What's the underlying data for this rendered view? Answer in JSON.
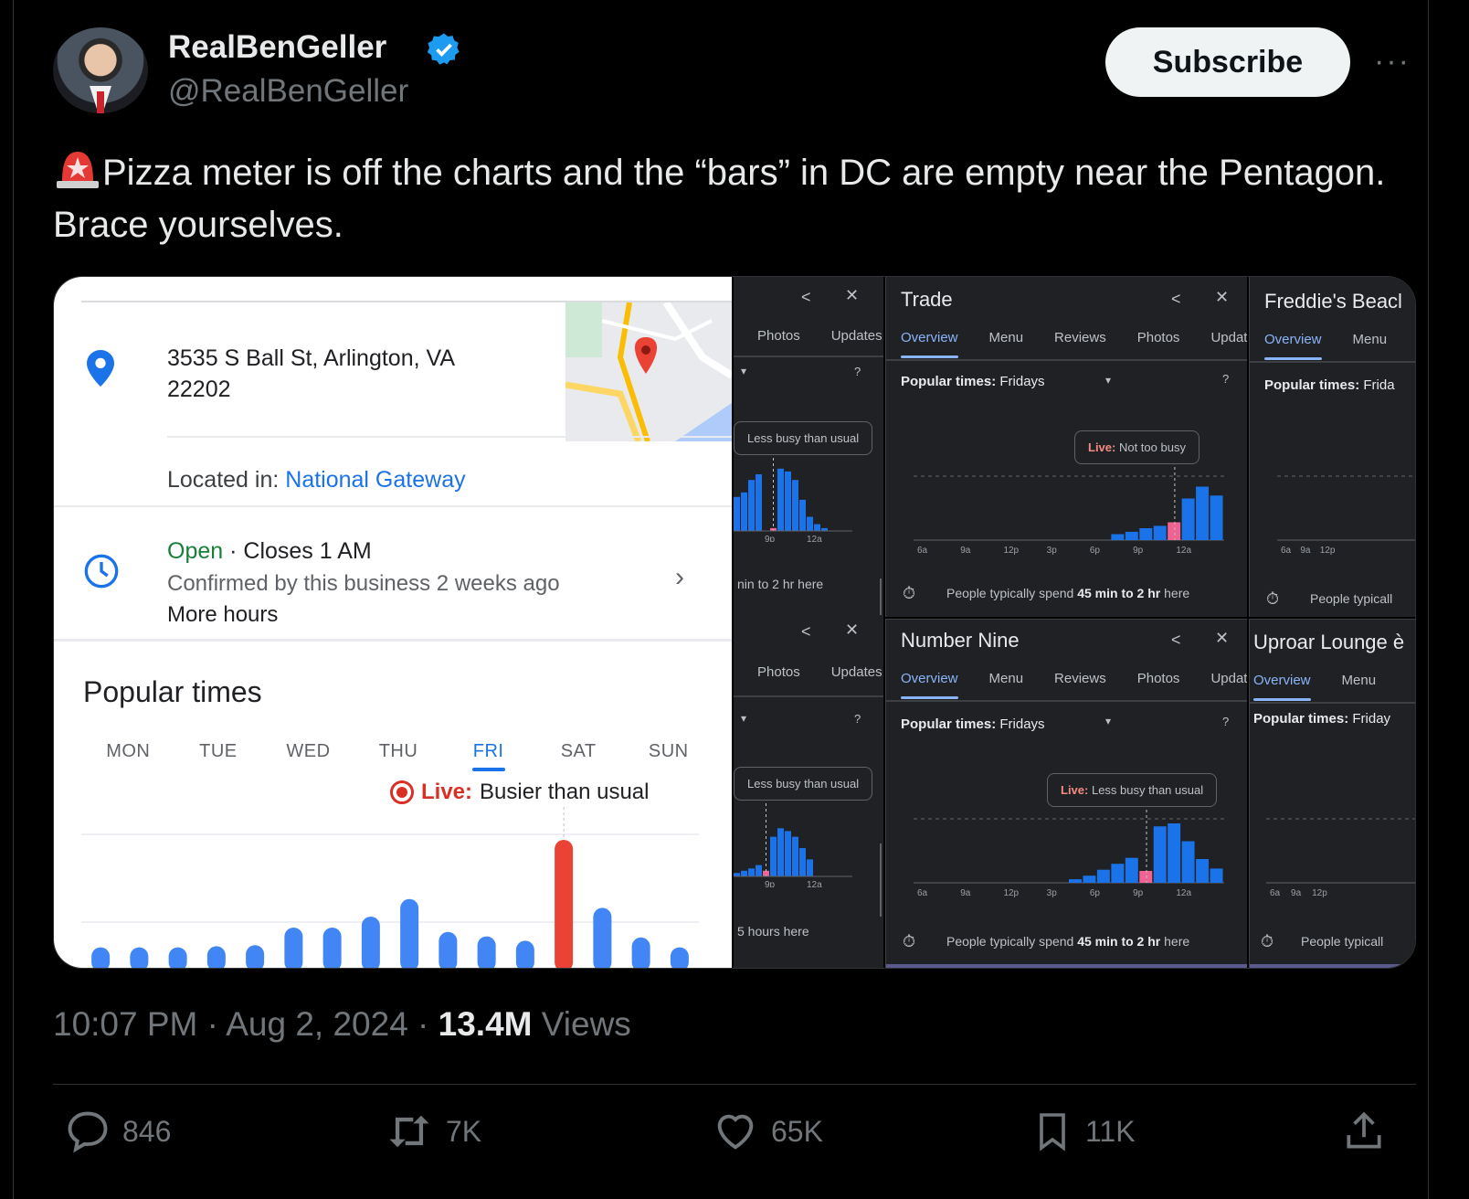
{
  "author": {
    "name": "RealBenGeller",
    "handle": "@RealBenGeller"
  },
  "subscribe_label": "Subscribe",
  "more_label": "···",
  "tweet": {
    "text": "Pizza meter is off the charts and the “bars” in DC are empty near the Pentagon. Brace yourselves."
  },
  "media": {
    "left": {
      "address_line1": "3535 S Ball St, Arlington, VA",
      "address_line2": "22202",
      "located_prefix": "Located in: ",
      "located_link": "National Gateway",
      "open": "Open",
      "closes": " · Closes 1 AM",
      "confirmed": "Confirmed by this business 2 weeks ago",
      "more_hours": "More hours",
      "popular_title": "Popular times",
      "days": [
        "MON",
        "TUE",
        "WED",
        "THU",
        "FRI",
        "SAT",
        "SUN"
      ],
      "active_day": "FRI",
      "live_label": "Live:",
      "live_text": "Busier than usual",
      "bars": [
        2,
        2,
        2,
        3,
        4,
        20,
        20,
        30,
        46,
        16,
        12,
        8,
        100,
        38,
        11,
        2
      ],
      "live_index": 12
    },
    "partial_top": {
      "tabs": [
        "Photos",
        "Updates"
      ],
      "bubble": "Less busy than usual",
      "foot": "nin to 2 hr here",
      "axis": [
        "9p",
        "12a"
      ]
    },
    "partial_bottom": {
      "tabs": [
        "Photos",
        "Updates"
      ],
      "bubble": "Less busy than usual",
      "foot": "5 hours here",
      "axis": [
        "9p",
        "12a"
      ]
    },
    "trade": {
      "title": "Trade",
      "tabs": [
        "Overview",
        "Menu",
        "Reviews",
        "Photos",
        "Updates"
      ],
      "popular_label": "Popular times:",
      "popular_day": "Fridays",
      "live_label": "Live:",
      "live_text": "Not too busy",
      "axis": [
        "6a",
        "9a",
        "12p",
        "3p",
        "6p",
        "9p",
        "12a"
      ],
      "foot_prefix": "People typically spend ",
      "foot_bold": "45 min to 2 hr",
      "foot_suffix": " here"
    },
    "number_nine": {
      "title": "Number Nine",
      "tabs": [
        "Overview",
        "Menu",
        "Reviews",
        "Photos",
        "Updates"
      ],
      "popular_label": "Popular times:",
      "popular_day": "Fridays",
      "live_label": "Live:",
      "live_text": "Less busy than usual",
      "axis": [
        "6a",
        "9a",
        "12p",
        "3p",
        "6p",
        "9p",
        "12a"
      ],
      "foot_prefix": "People typically spend ",
      "foot_bold": "45 min to 2 hr",
      "foot_suffix": " here"
    },
    "freddies": {
      "title": "Freddie's Beacl",
      "tabs": [
        "Overview",
        "Menu"
      ],
      "popular_label": "Popular times:",
      "popular_day": "Frida",
      "axis": [
        "6a",
        "9a",
        "12p"
      ],
      "foot": "People typicall"
    },
    "uproar": {
      "title": "Uproar Lounge è",
      "tabs": [
        "Overview",
        "Menu"
      ],
      "popular_label": "Popular times:",
      "popular_day": "Friday",
      "axis": [
        "6a",
        "9a",
        "12p"
      ],
      "foot": "People typicall"
    }
  },
  "meta": {
    "time": "10:07 PM · Aug 2, 2024 · ",
    "views_count": "13.4M",
    "views_label": " Views"
  },
  "actions": {
    "replies": "846",
    "reposts": "7K",
    "likes": "65K",
    "bookmarks": "11K"
  },
  "colors": {
    "accent": "#1d9bf0",
    "bar_blue": "#4285f4",
    "bar_live": "#ea4335",
    "dark_bar": "#1a73e8",
    "dark_live": "#f06292"
  }
}
